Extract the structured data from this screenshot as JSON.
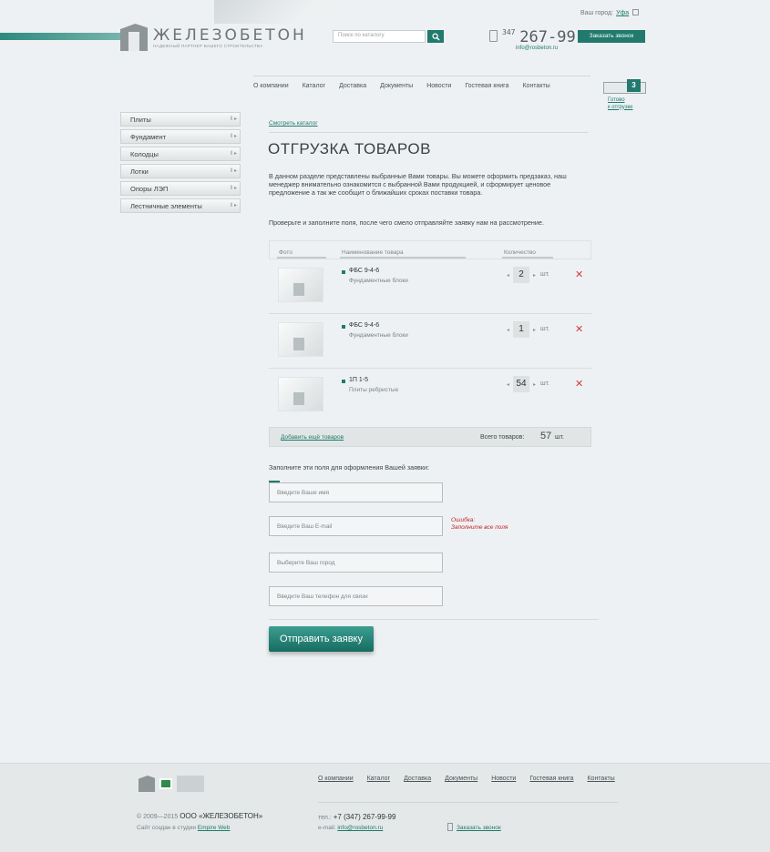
{
  "header": {
    "logo_name": "ЖЕЛЕЗОБЕТОН",
    "logo_tagline": "НАДЕЖНЫЙ ПАРТНЕР ВАШЕГО СТРОИТЕЛЬСТВА",
    "search_placeholder": "Поиск по каталогу",
    "city_label": "Ваш город:",
    "city_value": "Уфа",
    "phone_code": "347",
    "phone_number": "267-99-99",
    "email": "info@rosbeton.ru",
    "callback_label": "Заказать звонок"
  },
  "nav": [
    "О компании",
    "Каталог",
    "Доставка",
    "Документы",
    "Новости",
    "Гостевая книга",
    "Контакты"
  ],
  "cart": {
    "count": "3",
    "label_line1": "Готово",
    "label_line2": "к отгрузке"
  },
  "sidebar": [
    "Плиты",
    "Фундамент",
    "Колодцы",
    "Лотки",
    "Опоры ЛЭП",
    "Лестничные элементы"
  ],
  "content": {
    "breadcrumb": "Смотреть каталог",
    "title": "ОТГРУЗКА ТОВАРОВ",
    "intro": "В данном разделе представлены выбранные Вами товары. Вы можете оформить предзаказ, наш менеджер внимательно ознакомится с выбранной Вами продукцией, и сформирует ценовое предложение а так же сообщит о ближайших сроках поставки товара.",
    "intro2": "Проверьте и заполните поля, после чего смело отправляйте заявку нам на рассмотрение."
  },
  "table": {
    "headers": {
      "photo": "Фото",
      "name": "Наименование товара",
      "qty": "Количество"
    },
    "rows": [
      {
        "name": "ФБС 9-4-6",
        "category": "Фундаментные блоки",
        "qty": "2",
        "unit": "шт."
      },
      {
        "name": "ФБС 9-4-6",
        "category": "Фундаментные блоки",
        "qty": "1",
        "unit": "шт."
      },
      {
        "name": "1П 1-5",
        "category": "Плиты ребристые",
        "qty": "54",
        "unit": "шт."
      }
    ]
  },
  "summary": {
    "add_link": "Добавить ещё товаров",
    "total_label": "Всего товаров:",
    "total_count": "57",
    "unit": "шт."
  },
  "form": {
    "title": "Заполните эти поля для оформления Вашей заявки:",
    "name_placeholder": "Введите Ваше имя",
    "email_placeholder": "Введите Ваш E-mail",
    "city_placeholder": "Выберите Ваш город",
    "phone_placeholder": "Введите Ваш телефон для связи",
    "error_title": "Ошибка:",
    "error_text": "Заполните все поля",
    "submit": "Отправить заявку"
  },
  "footer": {
    "nav": [
      "О компании",
      "Каталог",
      "Доставка",
      "Документы",
      "Новости",
      "Гостевая книга",
      "Контакты"
    ],
    "copyright_years": "© 2009—2015",
    "copyright_org": "ООО «ЖЕЛЕЗОБЕТОН»",
    "studio_prefix": "Сайт создан в студии",
    "studio_name": "Empire Web",
    "tel_prefix": "тел.:",
    "tel": "+7 (347) 267-99-99",
    "mail_prefix": "e-mail:",
    "mail": "info@rosbeton.ru",
    "callback": "Заказать звонок"
  }
}
